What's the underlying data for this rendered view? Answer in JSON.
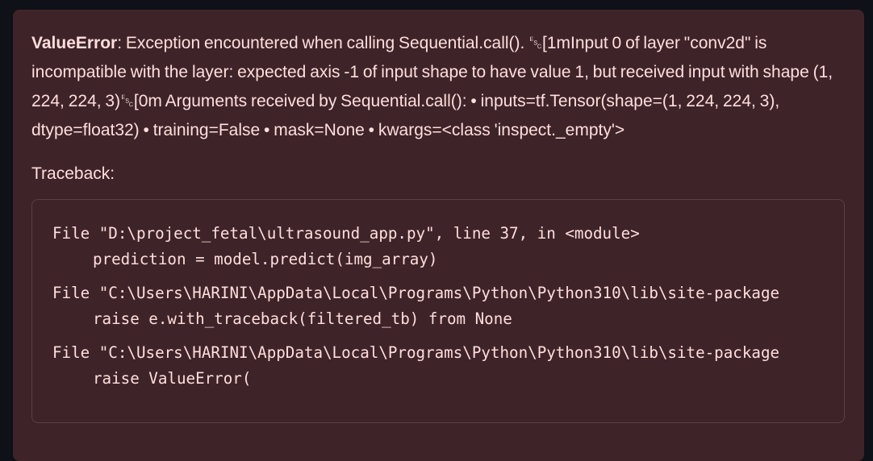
{
  "error": {
    "type": "ValueError",
    "message_rest": ": Exception encountered when calling Sequential.call(). ␛[1mInput 0 of layer \"conv2d\" is incompatible with the layer: expected axis -1 of input shape to have value 1, but received input with shape (1, 224, 224, 3)␛[0m Arguments received by Sequential.call(): • inputs=tf.Tensor(shape=(1, 224, 224, 3), dtype=float32) • training=False • mask=None • kwargs=<class 'inspect._empty'>"
  },
  "traceback": {
    "label": "Traceback:",
    "frames": [
      {
        "file_line": "File \"D:\\project_fetal\\ultrasound_app.py\", line 37, in <module>",
        "code_line": "prediction = model.predict(img_array)"
      },
      {
        "file_line": "File \"C:\\Users\\HARINI\\AppData\\Local\\Programs\\Python\\Python310\\lib\\site-package",
        "code_line": "raise e.with_traceback(filtered_tb) from None"
      },
      {
        "file_line": "File \"C:\\Users\\HARINI\\AppData\\Local\\Programs\\Python\\Python310\\lib\\site-package",
        "code_line": "raise ValueError("
      }
    ]
  },
  "colors": {
    "page_background": "#0e1117",
    "alert_background": "#3e2428",
    "alert_text": "#ffdede",
    "box_border": "#5a4044"
  }
}
